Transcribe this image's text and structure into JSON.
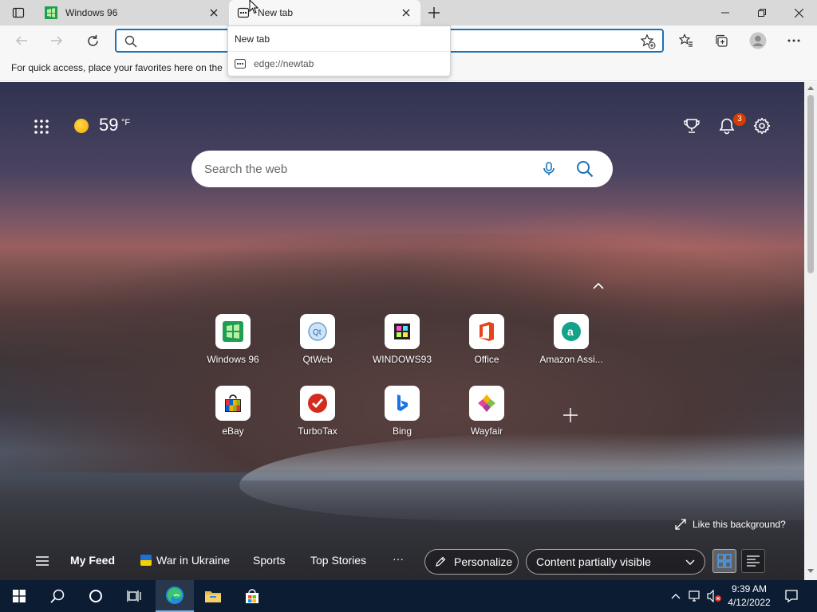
{
  "tabs": [
    {
      "title": "Windows 96",
      "active": false
    },
    {
      "title": "New tab",
      "active": true
    }
  ],
  "address_bar": {
    "value": "",
    "placeholder": ""
  },
  "favorites_bar": {
    "message": "For quick access, place your favorites here on the"
  },
  "dropdown": {
    "header": "New tab",
    "item": "edge://newtab"
  },
  "weather": {
    "temperature": "59",
    "unit": "°F"
  },
  "notifications": {
    "count": "3"
  },
  "search": {
    "placeholder": "Search the web"
  },
  "quick_links": [
    {
      "label": "Windows 96",
      "icon": "windows96-icon"
    },
    {
      "label": "QtWeb",
      "icon": "qtweb-icon"
    },
    {
      "label": "WINDOWS93",
      "icon": "windows93-icon"
    },
    {
      "label": "Office",
      "icon": "office-icon"
    },
    {
      "label": "Amazon Assi...",
      "icon": "amazon-icon"
    },
    {
      "label": "eBay",
      "icon": "ebay-icon"
    },
    {
      "label": "TurboTax",
      "icon": "turbotax-icon"
    },
    {
      "label": "Bing",
      "icon": "bing-icon"
    },
    {
      "label": "Wayfair",
      "icon": "wayfair-icon"
    }
  ],
  "background": {
    "like_label": "Like this background?"
  },
  "feed": {
    "my_feed": "My Feed",
    "war_in_ukraine": "War in Ukraine",
    "sports": "Sports",
    "top_stories": "Top Stories",
    "more": "···",
    "personalize": "Personalize",
    "content_visibility": "Content partially visible"
  },
  "taskbar": {
    "time": "9:39 AM",
    "date": "4/12/2022"
  },
  "colors": {
    "accent": "#1a73b8",
    "badge": "#d83b01",
    "taskbar": "#0b1c33"
  }
}
